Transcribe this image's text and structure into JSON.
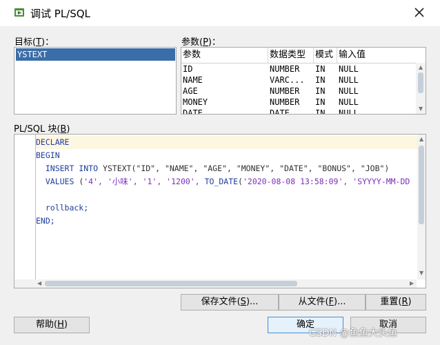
{
  "window": {
    "title": "调试 PL/SQL",
    "icon": "plsql-debug-icon",
    "close_icon": "close-icon"
  },
  "target": {
    "label_prefix": "目标(",
    "label_key": "T",
    "label_suffix": ")：",
    "items": [
      "YSTEXT"
    ]
  },
  "params": {
    "label_prefix": "参数(",
    "label_key": "P",
    "label_suffix": ")：",
    "columns": [
      "参数",
      "数据类型",
      "模式",
      "输入值"
    ],
    "rows": [
      {
        "name": "ID",
        "type": "NUMBER",
        "mode": "IN",
        "value": "NULL"
      },
      {
        "name": "NAME",
        "type": "VARC...",
        "mode": "IN",
        "value": "NULL"
      },
      {
        "name": "AGE",
        "type": "NUMBER",
        "mode": "IN",
        "value": "NULL"
      },
      {
        "name": "MONEY",
        "type": "NUMBER",
        "mode": "IN",
        "value": "NULL"
      },
      {
        "name": "DATE",
        "type": "DATE",
        "mode": "IN",
        "value": "NULL"
      }
    ]
  },
  "block": {
    "label_prefix": "PL/SQL 块(",
    "label_key": "B",
    "label_suffix": ")",
    "line1": "DECLARE",
    "line2": "BEGIN",
    "line3_kw": "  INSERT INTO ",
    "line3_rest": "YSTEXT(\"ID\", \"NAME\", \"AGE\", \"MONEY\", \"DATE\", \"BONUS\", \"JOB\")",
    "line4_kw": "  VALUES ",
    "line4_a": "(",
    "line4_str": "'4', '小味', '1', '1200', ",
    "line4_fn": "TO_DATE",
    "line4_b": "(",
    "line4_str2": "'2020-08-08 13:58:09', 'SYYYY-MM-DD",
    "line6": "  rollback;",
    "line7": "END;"
  },
  "buttons": {
    "save_prefix": "保存文件(",
    "save_key": "S",
    "save_suffix": ")...",
    "load_prefix": "从文件(",
    "load_key": "F",
    "load_suffix": ")...",
    "reset_prefix": "重置(",
    "reset_key": "R",
    "reset_suffix": ")",
    "help_prefix": "帮助(",
    "help_key": "H",
    "help_suffix": ")",
    "ok": "确定",
    "cancel": "取消"
  },
  "watermark": "CSDN @鱼鱼大头鱼"
}
